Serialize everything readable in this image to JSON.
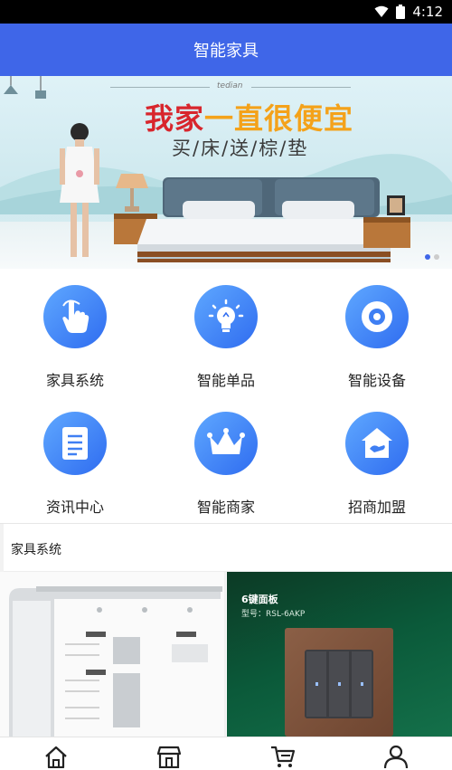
{
  "status_bar": {
    "time": "4:12",
    "icons": [
      "wifi-icon",
      "battery-icon"
    ]
  },
  "app_bar": {
    "title": "智能家具"
  },
  "banner": {
    "script_text": "tedian",
    "headline_part1": "我家",
    "headline_part2": "一直很便宜",
    "subline": "买/床/送/棕/垫",
    "page_dots": 2,
    "active_dot": 1
  },
  "categories": [
    {
      "label": "家具系统",
      "icon": "hand-tap-icon"
    },
    {
      "label": "智能单品",
      "icon": "light-bulb-icon"
    },
    {
      "label": "智能设备",
      "icon": "disc-icon"
    },
    {
      "label": "资讯中心",
      "icon": "document-icon"
    },
    {
      "label": "智能商家",
      "icon": "crown-icon"
    },
    {
      "label": "招商加盟",
      "icon": "house-hand-icon"
    }
  ],
  "section": {
    "title": "家具系统"
  },
  "products": {
    "switch_panel": {
      "title": "6键面板",
      "model": "型号：RSL-6AKP"
    }
  },
  "bottom_nav": [
    "home-icon",
    "store-icon",
    "cart-icon",
    "user-icon"
  ],
  "colors": {
    "primary": "#3f66e8",
    "icon_gradient_start": "#5fa8ff",
    "icon_gradient_end": "#2f6cf0"
  }
}
